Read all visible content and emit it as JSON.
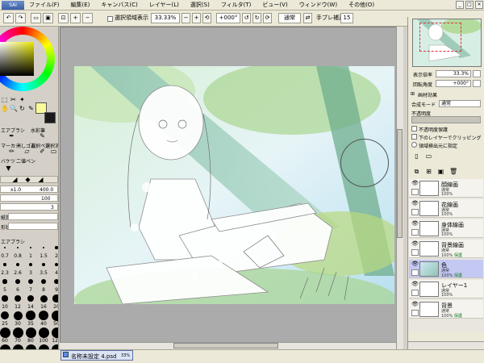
{
  "menu": {
    "app_label": "SAI",
    "items": [
      "ファイル(F)",
      "編集(E)",
      "キャンバス(C)",
      "レイヤー(L)",
      "選択(S)",
      "フィルタ(T)",
      "ビュー(V)",
      "ウィンドウ(W)",
      "その他(O)"
    ]
  },
  "toolbar": {
    "show_selection_label": "選択領域表示",
    "zoom_value": "33.33%",
    "rotation_value": "+000°",
    "blend_mode": "通常",
    "stabilizer_label": "手ブレ補正",
    "stabilizer_value": "15"
  },
  "tools": {
    "labels": [
      "エアブラシ",
      "水彩筆",
      "マーカー",
      "消しゴム",
      "選択ペン",
      "選択消",
      "バケツ",
      "二値ペン"
    ],
    "size_multiplier": "x1.0",
    "size_value": "400.0",
    "density_value": "100",
    "min_size_value": "3",
    "texture_label": "紙質",
    "shape_label": "形状",
    "sizes": [
      [
        "0.7",
        "0.8",
        "1",
        "1.5",
        "2"
      ],
      [
        "2.3",
        "2.6",
        "3",
        "3.5",
        "4"
      ],
      [
        "5",
        "6",
        "7",
        "8",
        "9"
      ],
      [
        "10",
        "12",
        "14",
        "16",
        "20"
      ],
      [
        "25",
        "30",
        "35",
        "40",
        "50"
      ],
      [
        "60",
        "70",
        "80",
        "100",
        "120"
      ],
      [
        "160",
        "200",
        "250",
        "300",
        "350"
      ]
    ]
  },
  "colors": {
    "primary": "#fafa9a",
    "secondary": "#1a1a1a",
    "selected_layer": "#c4c9f4"
  },
  "navigator": {
    "zoom_label": "表示倍率",
    "zoom_value": "33.3%",
    "angle_label": "回転角度",
    "angle_value": "+000°"
  },
  "layer_panel": {
    "effect_label": "画材効果",
    "blend_label": "合成モード",
    "blend_value": "通常",
    "opacity_label": "不透明度",
    "opacity_value": "100%",
    "opts": [
      "不透明度保護",
      "下のレイヤーでクリッピング",
      "領域検出元に指定"
    ]
  },
  "layers": [
    {
      "name": "顔線画",
      "mode": "通常",
      "opacity": "100%",
      "protect": "",
      "selected": false
    },
    {
      "name": "花線画",
      "mode": "通常",
      "opacity": "100%",
      "protect": "",
      "selected": false
    },
    {
      "name": "身体線画",
      "mode": "通常",
      "opacity": "100%",
      "protect": "",
      "selected": false
    },
    {
      "name": "背景線画",
      "mode": "通常",
      "opacity": "100%",
      "protect": "保護",
      "selected": false
    },
    {
      "name": "色",
      "mode": "通常",
      "opacity": "100%",
      "protect": "保護",
      "selected": true
    },
    {
      "name": "レイヤー1",
      "mode": "通常",
      "opacity": "100%",
      "protect": "",
      "selected": false
    },
    {
      "name": "背景",
      "mode": "通常",
      "opacity": "100%",
      "protect": "保護",
      "selected": false
    }
  ],
  "status": {
    "filename": "名称未設定 4.psd",
    "zoom": "33%"
  }
}
